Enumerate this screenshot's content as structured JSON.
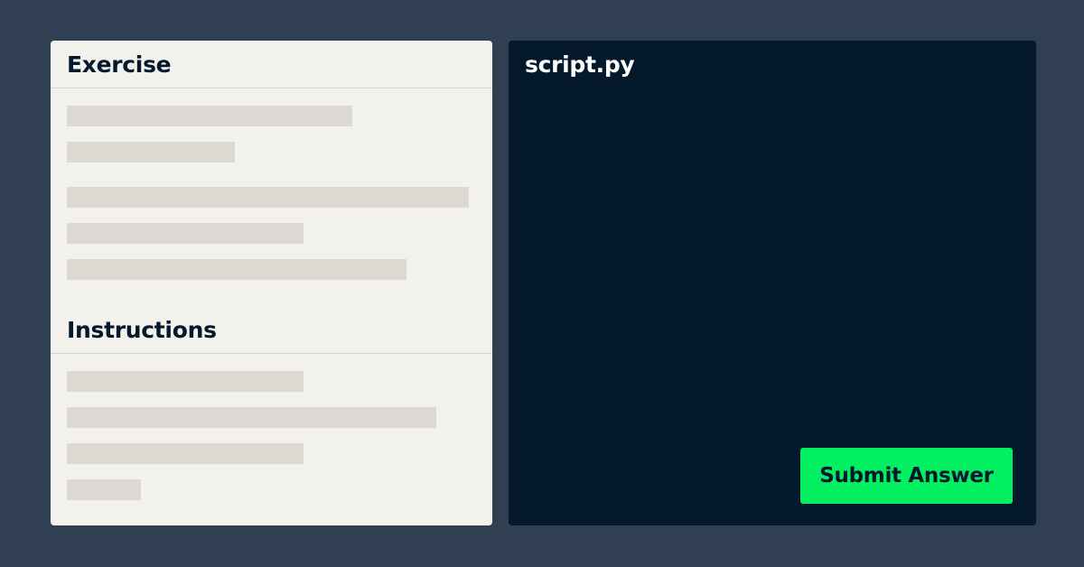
{
  "exercise_panel": {
    "exercise_title": "Exercise",
    "instructions_title": "Instructions"
  },
  "editor_panel": {
    "file_name": "script.py",
    "submit_label": "Submit Answer"
  },
  "colors": {
    "background": "#303f51",
    "left_panel": "#f3f1eb",
    "editor": "#05192d",
    "placeholder": "#dcd9d3",
    "submit_button": "#03ef62"
  }
}
